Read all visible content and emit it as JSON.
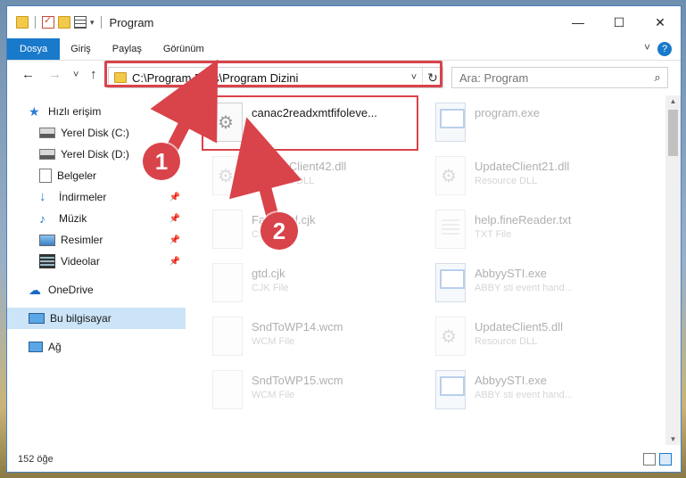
{
  "window": {
    "title": "Program"
  },
  "titlebar_buttons": {
    "minimize": "—",
    "maximize": "☐",
    "close": "✕"
  },
  "ribbon": {
    "tabs": [
      "Dosya",
      "Giriş",
      "Paylaş",
      "Görünüm"
    ],
    "help": "?"
  },
  "nav": {
    "back": "←",
    "forward": "→",
    "recent": "˅",
    "up": "↑"
  },
  "address": {
    "path": "C:\\Program Files\\Program Dizini",
    "dropdown": "˅",
    "refresh": "↻"
  },
  "search": {
    "placeholder": "Ara: Program"
  },
  "sidebar": {
    "items": [
      {
        "label": "Hızlı erişim",
        "icon": "star-icon"
      },
      {
        "label": "Yerel Disk (C:)",
        "icon": "drive-icon"
      },
      {
        "label": "Yerel Disk (D:)",
        "icon": "drive-icon"
      },
      {
        "label": "Belgeler",
        "icon": "documents-icon"
      },
      {
        "label": "İndirmeler",
        "icon": "download-icon"
      },
      {
        "label": "Müzik",
        "icon": "music-icon"
      },
      {
        "label": "Resimler",
        "icon": "pictures-icon"
      },
      {
        "label": "Videolar",
        "icon": "video-icon"
      },
      {
        "label": "OneDrive",
        "icon": "cloud-icon"
      },
      {
        "label": "Bu bilgisayar",
        "icon": "computer-icon"
      },
      {
        "label": "Ağ",
        "icon": "network-icon"
      }
    ],
    "pin": "📌"
  },
  "files": [
    {
      "name": "canac2readxmtfifoleve...",
      "type": "",
      "kind": "dll"
    },
    {
      "name": "program.exe",
      "type": "",
      "kind": "exe"
    },
    {
      "name": "UpdateClient42.dll",
      "type": "Resource DLL",
      "kind": "dll"
    },
    {
      "name": "UpdateClient21.dll",
      "type": "Resource DLL",
      "kind": "dll"
    },
    {
      "name": "FaxSend.cjk",
      "type": "CJK File",
      "kind": "doc"
    },
    {
      "name": "help.fineReader.txt",
      "type": "TXT File",
      "kind": "txt"
    },
    {
      "name": "gtd.cjk",
      "type": "CJK File",
      "kind": "doc"
    },
    {
      "name": "AbbyySTI.exe",
      "type": "ABBY sti event hand...",
      "kind": "exe"
    },
    {
      "name": "SndToWP14.wcm",
      "type": "WCM File",
      "kind": "doc"
    },
    {
      "name": "UpdateClient5.dll",
      "type": "Resource DLL",
      "kind": "dll"
    },
    {
      "name": "SndToWP15.wcm",
      "type": "WCM File",
      "kind": "doc"
    },
    {
      "name": "AbbyySTI.exe",
      "type": "ABBY sti event hand...",
      "kind": "exe"
    }
  ],
  "annotations": {
    "badge1": "1",
    "badge2": "2",
    "color": "#d9434a"
  },
  "status": {
    "count": "152 öğe"
  }
}
